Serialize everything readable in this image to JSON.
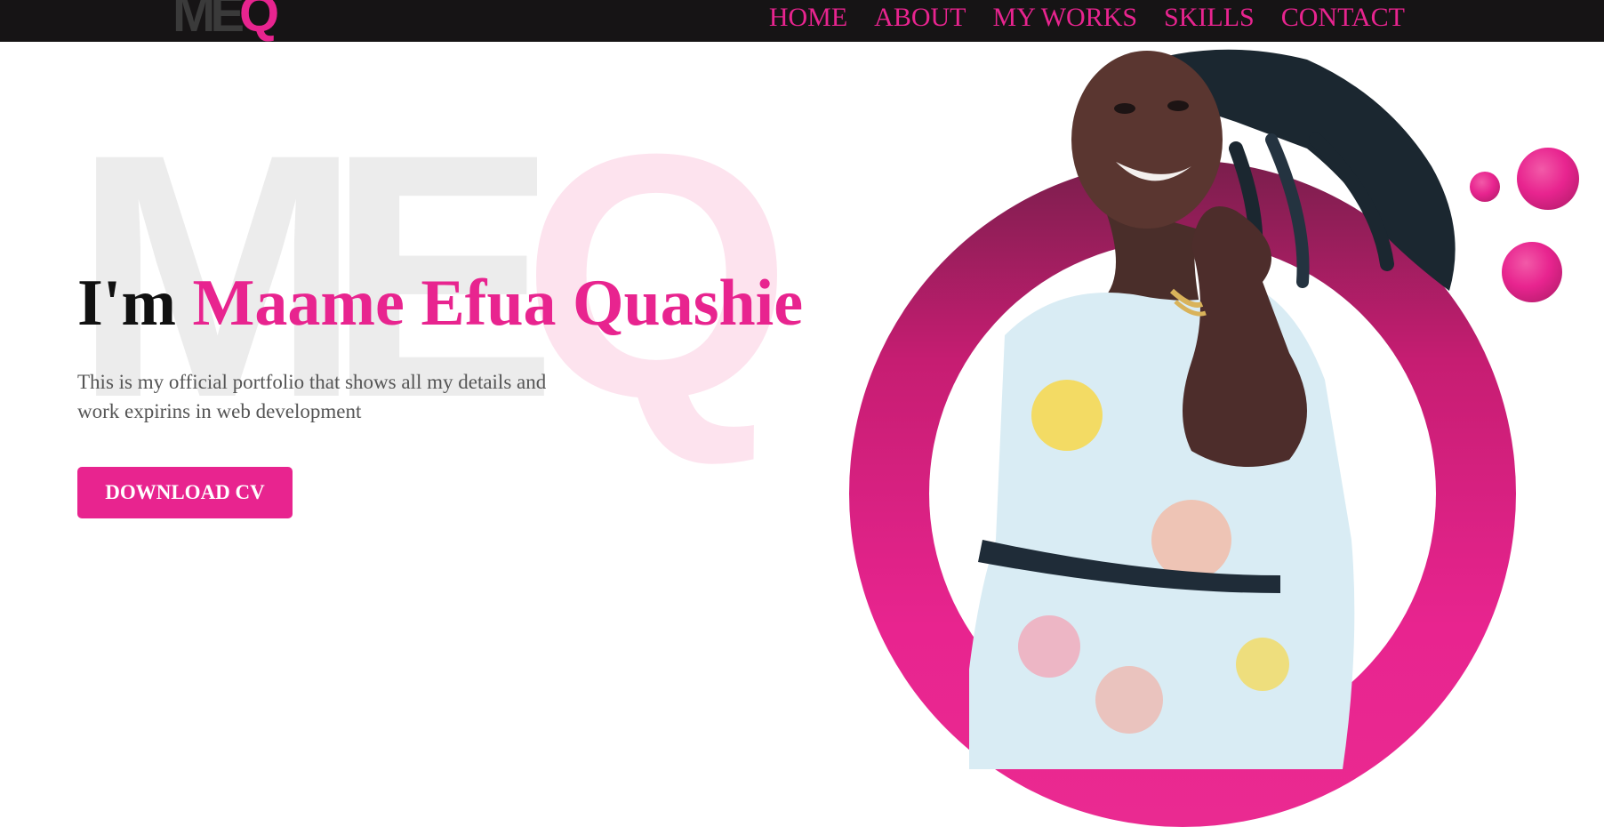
{
  "header": {
    "logo": {
      "part1": "ME",
      "part2": "Q"
    },
    "nav": [
      "HOME",
      "ABOUT",
      "MY WORKS",
      "SKILLS",
      "CONTACT"
    ]
  },
  "hero": {
    "watermark": {
      "part1": "ME",
      "part2": "Q"
    },
    "greeting": "I'm",
    "name": "Maame Efua Quashie",
    "intro": "This is my official portfolio that shows all my details and work expirins in web development",
    "cv_button": "DOWNLOAD CV"
  },
  "colors": {
    "accent": "#e8248f",
    "navbar": "#161415",
    "text": "#111111",
    "muted": "#555555"
  },
  "icons": [
    "profile-photo"
  ]
}
